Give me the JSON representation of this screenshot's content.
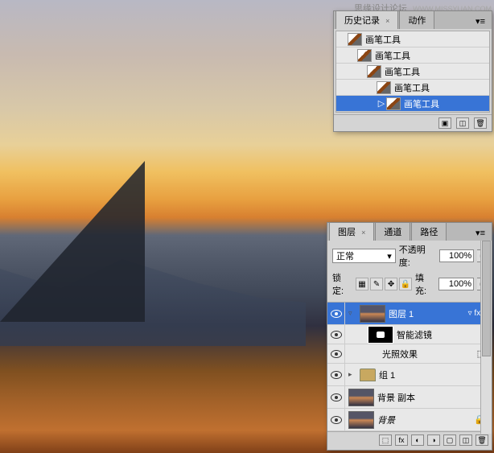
{
  "watermark": {
    "text": "思缘设计论坛",
    "url": "WWW.MISSYUAN.COM"
  },
  "history_panel": {
    "tabs": [
      {
        "label": "历史记录",
        "active": true
      },
      {
        "label": "动作",
        "active": false
      }
    ],
    "items": [
      {
        "label": "画笔工具",
        "selected": false
      },
      {
        "label": "画笔工具",
        "selected": false
      },
      {
        "label": "画笔工具",
        "selected": false
      },
      {
        "label": "画笔工具",
        "selected": false
      },
      {
        "label": "画笔工具",
        "selected": true
      }
    ]
  },
  "layers_panel": {
    "tabs": [
      {
        "label": "图层",
        "active": true
      },
      {
        "label": "通道",
        "active": false
      },
      {
        "label": "路径",
        "active": false
      }
    ],
    "blend_mode": "正常",
    "opacity_label": "不透明度:",
    "opacity_value": "100%",
    "lock_label": "锁定:",
    "fill_label": "填充:",
    "fill_value": "100%",
    "layers": [
      {
        "name": "图层 1",
        "type": "layer",
        "selected": true,
        "visible": true,
        "has_fx": true
      },
      {
        "name": "智能滤镜",
        "type": "smartfilter",
        "visible": true,
        "indent": 1
      },
      {
        "name": "光照效果",
        "type": "effect",
        "visible": true,
        "indent": 2
      },
      {
        "name": "组 1",
        "type": "group",
        "visible": true,
        "expanded": false
      },
      {
        "name": "背景 副本",
        "type": "layer",
        "visible": true
      },
      {
        "name": "背景",
        "type": "background",
        "visible": true
      }
    ],
    "footer_icons": [
      "fx",
      "mask",
      "adjust",
      "group",
      "new",
      "trash"
    ]
  }
}
